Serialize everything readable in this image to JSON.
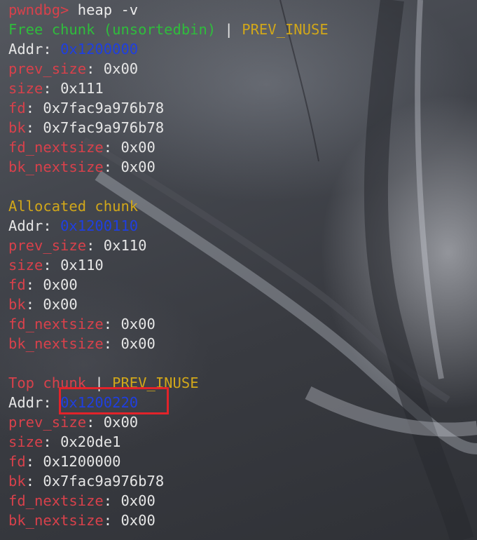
{
  "terminal": {
    "prompt": "pwndbg>",
    "command": "heap -v",
    "chunks": [
      {
        "title": "Free chunk (unsortedbin)",
        "separator": " | ",
        "flag": "PREV_INUSE",
        "addr_label": "Addr",
        "addr": "0x1200000",
        "fields": [
          {
            "name": "prev_size",
            "value": "0x00"
          },
          {
            "name": "size",
            "value": "0x111"
          },
          {
            "name": "fd",
            "value": "0x7fac9a976b78"
          },
          {
            "name": "bk",
            "value": "0x7fac9a976b78"
          },
          {
            "name": "fd_nextsize",
            "value": "0x00"
          },
          {
            "name": "bk_nextsize",
            "value": "0x00"
          }
        ]
      },
      {
        "title": "Allocated chunk",
        "addr_label": "Addr",
        "addr": "0x1200110",
        "fields": [
          {
            "name": "prev_size",
            "value": "0x110"
          },
          {
            "name": "size",
            "value": "0x110"
          },
          {
            "name": "fd",
            "value": "0x00"
          },
          {
            "name": "bk",
            "value": "0x00"
          },
          {
            "name": "fd_nextsize",
            "value": "0x00"
          },
          {
            "name": "bk_nextsize",
            "value": "0x00"
          }
        ]
      },
      {
        "title": "Top chunk",
        "separator": " | ",
        "flag": "PREV_INUSE",
        "addr_label": "Addr",
        "addr": "0x1200220",
        "fields": [
          {
            "name": "prev_size",
            "value": "0x00"
          },
          {
            "name": "size",
            "value": "0x20de1"
          },
          {
            "name": "fd",
            "value": "0x1200000"
          },
          {
            "name": "bk",
            "value": "0x7fac9a976b78"
          },
          {
            "name": "fd_nextsize",
            "value": "0x00"
          },
          {
            "name": "bk_nextsize",
            "value": "0x00"
          }
        ]
      }
    ]
  },
  "colors": {
    "prompt": "#d8414b",
    "free_title": "#2fbd3c",
    "flag": "#d1a71a",
    "allocated_title": "#d1a71a",
    "top_title": "#d8414b",
    "field_name": "#d8414b",
    "address": "#1f3fe0",
    "highlight_box": "#e2232a"
  }
}
